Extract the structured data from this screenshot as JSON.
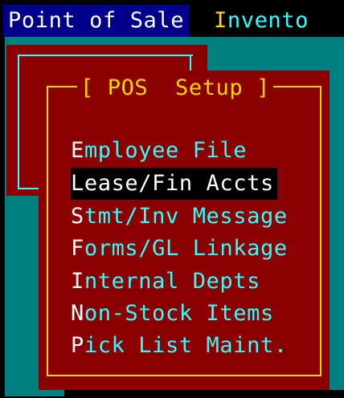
{
  "menubar": {
    "point_of_sale": "Point of Sale",
    "inventory_hot": "I",
    "inventory_rest": "nvento"
  },
  "setup_window": {
    "title": "[ POS  Setup ]",
    "items": [
      {
        "hot": "E",
        "rest": "mployee File",
        "selected": false
      },
      {
        "hot": "L",
        "rest": "ease/Fin Accts",
        "selected": true
      },
      {
        "hot": "S",
        "rest": "tmt/Inv Message",
        "selected": false
      },
      {
        "hot": "F",
        "rest": "orms/GL Linkage",
        "selected": false
      },
      {
        "hot": "I",
        "rest": "nternal Depts",
        "selected": false
      },
      {
        "hot": "N",
        "rest": "on-Stock Items",
        "selected": false
      },
      {
        "hot": "P",
        "rest": "ick List Maint.",
        "selected": false
      }
    ]
  },
  "colors": {
    "menubar_highlight": "#00008b",
    "desktop": "#008080",
    "window": "#8b0000",
    "border": "#ffd700",
    "text": "#33ffff",
    "selected_bg": "#000000"
  }
}
